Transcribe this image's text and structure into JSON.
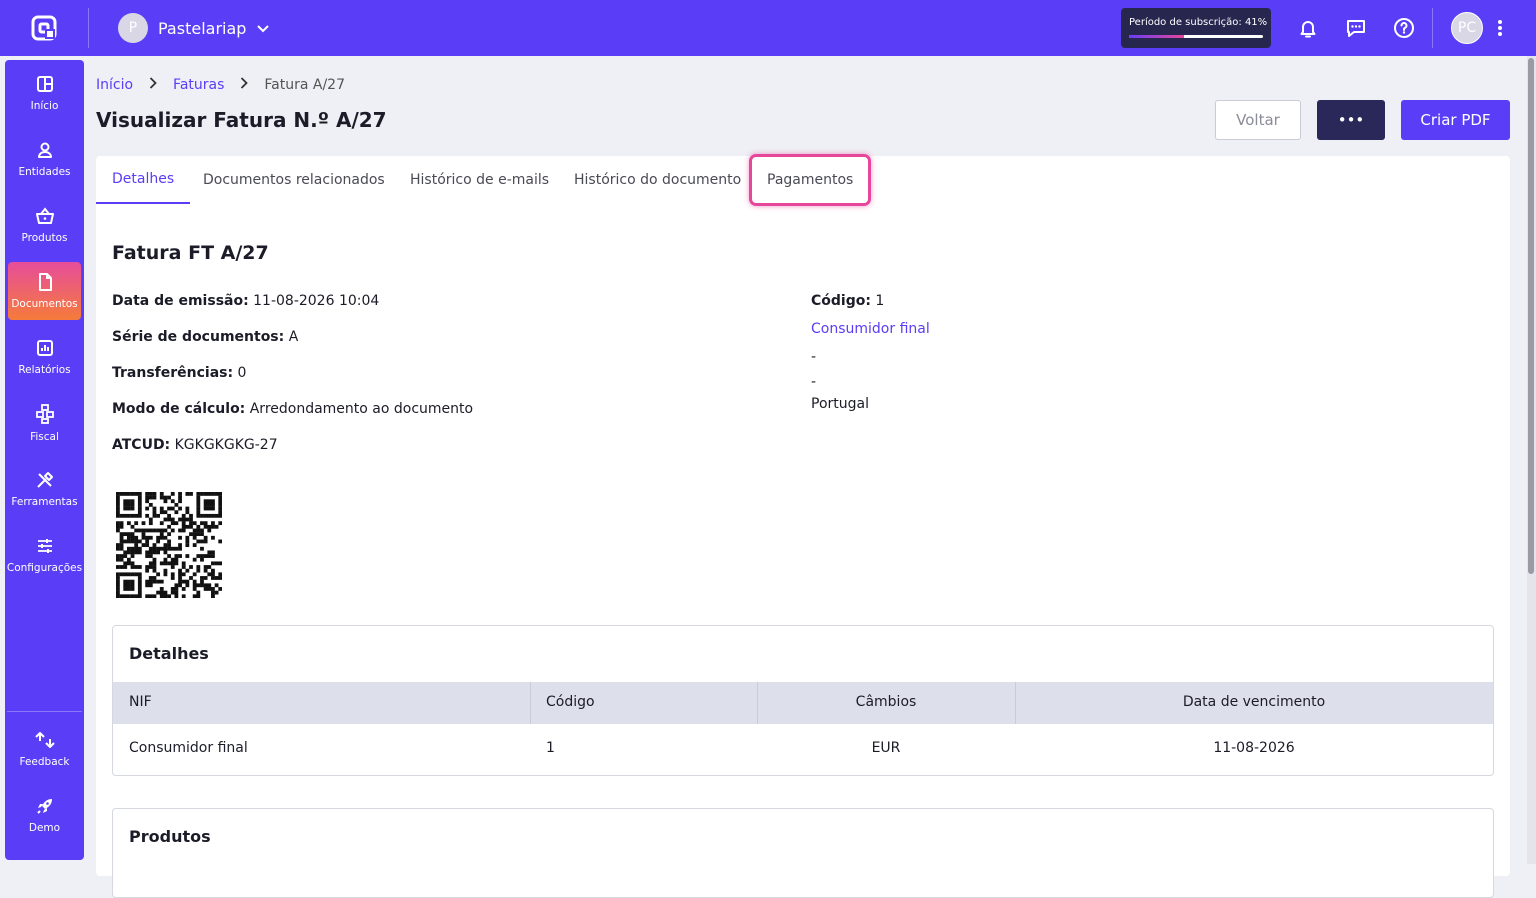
{
  "header": {
    "company_initial": "P",
    "company_name": "Pastelariap",
    "subscription_label": "Período de subscrição: 41%",
    "subscription_progress": 0.41,
    "user_initials": "PC"
  },
  "sidebar": {
    "items": [
      {
        "label": "Início",
        "icon": "dashboard-icon"
      },
      {
        "label": "Entidades",
        "icon": "user-icon"
      },
      {
        "label": "Produtos",
        "icon": "basket-icon"
      },
      {
        "label": "Documentos",
        "icon": "document-icon"
      },
      {
        "label": "Relatórios",
        "icon": "chart-icon"
      },
      {
        "label": "Fiscal",
        "icon": "hierarchy-icon"
      },
      {
        "label": "Ferramentas",
        "icon": "tools-icon"
      },
      {
        "label": "Configurações",
        "icon": "sliders-icon"
      }
    ],
    "bottom": [
      {
        "label": "Feedback",
        "icon": "feedback-icon"
      },
      {
        "label": "Demo",
        "icon": "rocket-icon"
      }
    ]
  },
  "breadcrumb": {
    "home": "Início",
    "section": "Faturas",
    "current": "Fatura A/27"
  },
  "page": {
    "title": "Visualizar Fatura N.º A/27"
  },
  "actions": {
    "back": "Voltar",
    "more": "•••",
    "pdf": "Criar PDF"
  },
  "tabs": [
    "Detalhes",
    "Documentos relacionados",
    "Histórico de e-mails",
    "Histórico do documento",
    "Pagamentos"
  ],
  "document": {
    "title": "Fatura FT A/27",
    "fields": [
      {
        "label": "Data de emissão:",
        "value": " 11-08-2026 10:04"
      },
      {
        "label": "Série de documentos:",
        "value": " A"
      },
      {
        "label": "Transferências:",
        "value": " 0"
      },
      {
        "label": "Modo de cálculo:",
        "value": " Arredondamento ao documento"
      },
      {
        "label": "ATCUD:",
        "value": " KGKGKGKG-27"
      }
    ],
    "client": {
      "code_label": "Código:",
      "code_value": " 1",
      "name": "Consumidor final",
      "line1": "-",
      "line2": "-",
      "country": "Portugal"
    }
  },
  "details_panel": {
    "title": "Detalhes",
    "columns": [
      "NIF",
      "Código",
      "Câmbios",
      "Data de vencimento"
    ],
    "row": [
      "Consumidor final",
      "1",
      "EUR",
      "11-08-2026"
    ]
  },
  "products_panel": {
    "title": "Produtos"
  }
}
